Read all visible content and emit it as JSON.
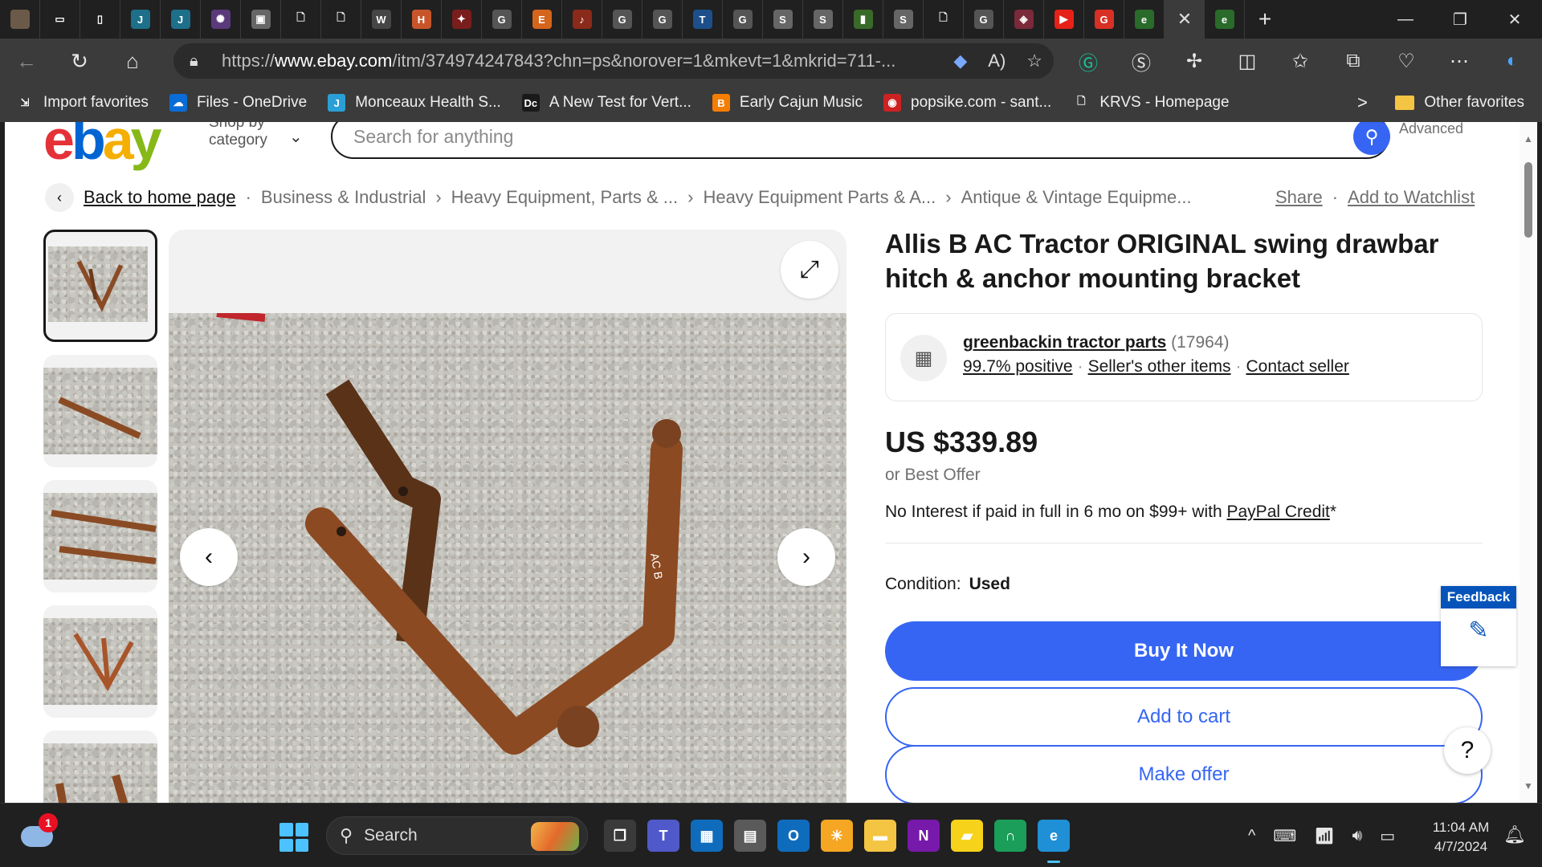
{
  "browser": {
    "url_prefix": "https://",
    "url_domain": "www.ebay.com",
    "url_rest": "/itm/374974247843?chn=ps&norover=1&mkevt=1&mkrid=711-...",
    "tab_favicons": [
      {
        "name": "avatar-tab-icon",
        "glyph": "",
        "color": "#6b5a4a"
      },
      {
        "name": "tab-actions-icon",
        "glyph": "▭",
        "color": "#202020"
      },
      {
        "name": "vertical-tabs-icon",
        "glyph": "▯",
        "color": "#202020"
      },
      {
        "name": "jimdo-tab-icon",
        "glyph": "J",
        "color": "#1d6f8a"
      },
      {
        "name": "jimdo-tab-icon",
        "glyph": "J",
        "color": "#1d6f8a"
      },
      {
        "name": "sparkle-tab-icon",
        "glyph": "✺",
        "color": "#5a3a7a"
      },
      {
        "name": "photo-tab-icon",
        "glyph": "▣",
        "color": "#666"
      },
      {
        "name": "page-tab-icon",
        "glyph": "🗋",
        "color": "#202020"
      },
      {
        "name": "page-tab-icon",
        "glyph": "🗋",
        "color": "#202020"
      },
      {
        "name": "wordpress-tab-icon",
        "glyph": "W",
        "color": "#464646"
      },
      {
        "name": "hardware-tab-icon",
        "glyph": "H",
        "color": "#c8552a"
      },
      {
        "name": "bird-tab-icon",
        "glyph": "✦",
        "color": "#7a1d1d"
      },
      {
        "name": "google-tab-icon",
        "glyph": "G",
        "color": "#555"
      },
      {
        "name": "etsy-tab-icon",
        "glyph": "E",
        "color": "#d5641c"
      },
      {
        "name": "music-tab-icon",
        "glyph": "♪",
        "color": "#8a2a1a"
      },
      {
        "name": "google-tab-icon",
        "glyph": "G",
        "color": "#555"
      },
      {
        "name": "google-tab-icon",
        "glyph": "G",
        "color": "#555"
      },
      {
        "name": "tractor-tab-icon",
        "glyph": "T",
        "color": "#1d4f8a"
      },
      {
        "name": "google-tab-icon",
        "glyph": "G",
        "color": "#555"
      },
      {
        "name": "stp-tab-icon",
        "glyph": "S",
        "color": "#666"
      },
      {
        "name": "stp-tab-icon",
        "glyph": "S",
        "color": "#666"
      },
      {
        "name": "book-tab-icon",
        "glyph": "▮",
        "color": "#3a6a2a"
      },
      {
        "name": "stp-tab-icon",
        "glyph": "S",
        "color": "#666"
      },
      {
        "name": "page-tab-icon",
        "glyph": "🗋",
        "color": "#202020"
      },
      {
        "name": "google-tab-icon",
        "glyph": "G",
        "color": "#555"
      },
      {
        "name": "app-tab-icon",
        "glyph": "◈",
        "color": "#7a2a3a"
      },
      {
        "name": "youtube-tab-icon",
        "glyph": "▶",
        "color": "#e62117"
      },
      {
        "name": "google-color-tab-icon",
        "glyph": "G",
        "color": "#d93025"
      },
      {
        "name": "ebay-tab-icon",
        "glyph": "e",
        "color": "#2a6a2a"
      }
    ],
    "active_tab_close": "✕",
    "inactive_ebay_tab": "e",
    "new_tab": "+",
    "window_controls": {
      "minimize": "—",
      "maximize": "❐",
      "close": "✕"
    }
  },
  "favorites": [
    {
      "label": "Import favorites",
      "icon": "import-icon",
      "glyph": "⇲",
      "color": "#3b3b3b"
    },
    {
      "label": "Files - OneDrive",
      "icon": "onedrive-icon",
      "glyph": "☁",
      "color": "#0a6cd6"
    },
    {
      "label": "Monceaux Health S...",
      "icon": "jimdo-icon",
      "glyph": "J",
      "color": "#2a9fd6"
    },
    {
      "label": "A New Test for Vert...",
      "icon": "dc-icon",
      "glyph": "Dc",
      "color": "#1a1a1a"
    },
    {
      "label": "Early Cajun Music",
      "icon": "blogger-icon",
      "glyph": "B",
      "color": "#f57d00"
    },
    {
      "label": "popsike.com - sant...",
      "icon": "popsike-icon",
      "glyph": "◉",
      "color": "#c22"
    },
    {
      "label": "KRVS - Homepage",
      "icon": "page-icon",
      "glyph": "🗋",
      "color": "#3b3b3b"
    }
  ],
  "favorites_more": ">",
  "other_favorites": "Other favorites",
  "ebay": {
    "shop_by": "Shop by",
    "category": "category",
    "search_placeholder": "Search for anything",
    "advanced": "Advanced",
    "breadcrumbs": [
      "Business & Industrial",
      "Heavy Equipment, Parts & ...",
      "Heavy Equipment Parts & A...",
      "Antique & Vintage Equipme..."
    ],
    "back_home": "Back to home page",
    "share": "Share",
    "add_watchlist": "Add to Watchlist",
    "title": "Allis B AC Tractor ORIGINAL swing drawbar hitch & anchor mounting bracket",
    "seller": {
      "name": "greenbackin tractor parts",
      "count": "(17964)",
      "positive": "99.7% positive",
      "other_items": "Seller's other items",
      "contact": "Contact seller"
    },
    "price": "US $339.89",
    "best_offer": "or Best Offer",
    "interest_text": "No Interest if paid in full in 6 mo on $99+ with ",
    "paypal": "PayPal Credit",
    "asterisk": "*",
    "condition_label": "Condition:",
    "condition_value": "Used",
    "buy_now": "Buy It Now",
    "add_cart": "Add to cart",
    "make_offer": "Make offer",
    "feedback": "Feedback",
    "help": "?",
    "image_text": "AC B"
  },
  "taskbar": {
    "weather_badge": "1",
    "search": "Search",
    "apps": [
      {
        "name": "task-view-icon",
        "glyph": "❐",
        "color": "#3a3a3a"
      },
      {
        "name": "teams-icon",
        "glyph": "T",
        "color": "#5059c9"
      },
      {
        "name": "calendar-icon",
        "glyph": "▦",
        "color": "#0f6cbd"
      },
      {
        "name": "calculator-icon",
        "glyph": "▤",
        "color": "#5a5a5a"
      },
      {
        "name": "outlook-icon",
        "glyph": "O",
        "color": "#0f6cbd"
      },
      {
        "name": "weather-app-icon",
        "glyph": "☀",
        "color": "#f5a623"
      },
      {
        "name": "file-explorer-icon",
        "glyph": "▬",
        "color": "#f4c542"
      },
      {
        "name": "onenote-icon",
        "glyph": "N",
        "color": "#7719aa"
      },
      {
        "name": "sticky-notes-icon",
        "glyph": "▰",
        "color": "#f7d21b"
      },
      {
        "name": "app-green-icon",
        "glyph": "∩",
        "color": "#1a9e5a"
      },
      {
        "name": "edge-icon",
        "glyph": "e",
        "color": "#1f8fd6"
      }
    ],
    "tray_chevron": "^",
    "time": "11:04 AM",
    "date": "4/7/2024"
  }
}
